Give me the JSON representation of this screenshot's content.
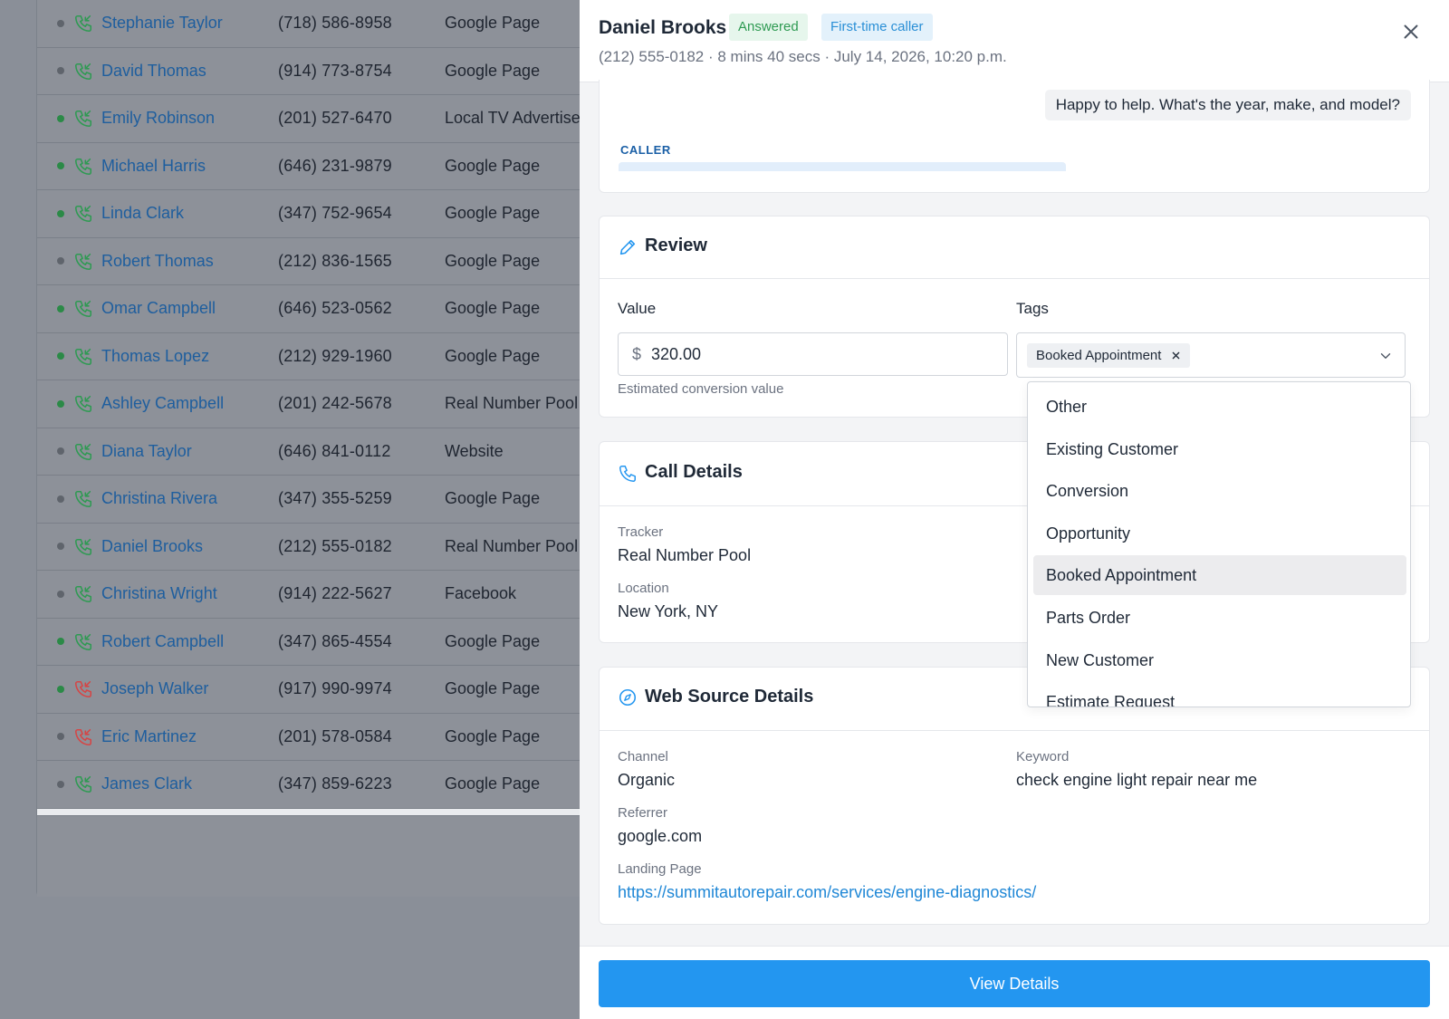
{
  "calls": [
    {
      "name": "Stephanie Taylor",
      "phone": "(718) 586-8958",
      "source": "Google Page",
      "status": "gray",
      "missed": false
    },
    {
      "name": "David Thomas",
      "phone": "(914) 773-8754",
      "source": "Google Page",
      "status": "gray",
      "missed": false
    },
    {
      "name": "Emily Robinson",
      "phone": "(201) 527-6470",
      "source": "Local TV Advertise",
      "status": "green",
      "missed": false
    },
    {
      "name": "Michael Harris",
      "phone": "(646) 231-9879",
      "source": "Google Page",
      "status": "green",
      "missed": false
    },
    {
      "name": "Linda Clark",
      "phone": "(347) 752-9654",
      "source": "Google Page",
      "status": "green",
      "missed": false
    },
    {
      "name": "Robert Thomas",
      "phone": "(212) 836-1565",
      "source": "Google Page",
      "status": "gray",
      "missed": false
    },
    {
      "name": "Omar Campbell",
      "phone": "(646) 523-0562",
      "source": "Google Page",
      "status": "green",
      "missed": false
    },
    {
      "name": "Thomas Lopez",
      "phone": "(212) 929-1960",
      "source": "Google Page",
      "status": "green",
      "missed": false
    },
    {
      "name": "Ashley Campbell",
      "phone": "(201) 242-5678",
      "source": "Real Number Pool",
      "status": "green",
      "missed": false
    },
    {
      "name": "Diana Taylor",
      "phone": "(646) 841-0112",
      "source": "Website",
      "status": "gray",
      "missed": false
    },
    {
      "name": "Christina Rivera",
      "phone": "(347) 355-5259",
      "source": "Google Page",
      "status": "gray",
      "missed": false
    },
    {
      "name": "Daniel Brooks",
      "phone": "(212) 555-0182",
      "source": "Real Number Pool",
      "status": "gray",
      "missed": false
    },
    {
      "name": "Christina Wright",
      "phone": "(914) 222-5627",
      "source": "Facebook",
      "status": "gray",
      "missed": false
    },
    {
      "name": "Robert Campbell",
      "phone": "(347) 865-4554",
      "source": "Google Page",
      "status": "green",
      "missed": false
    },
    {
      "name": "Joseph Walker",
      "phone": "(917) 990-9974",
      "source": "Google Page",
      "status": "green",
      "missed": true
    },
    {
      "name": "Eric Martinez",
      "phone": "(201) 578-0584",
      "source": "Google Page",
      "status": "gray",
      "missed": true
    },
    {
      "name": "James Clark",
      "phone": "(347) 859-6223",
      "source": "Google Page",
      "status": "gray",
      "missed": false
    }
  ],
  "drawer": {
    "name": "Daniel Brooks",
    "badge_answered": "Answered",
    "badge_first": "First-time caller",
    "subtitle": "(212) 555-0182 · 8 mins 40 secs · July 14, 2026, 10:20 p.m.",
    "close_icon": "close-icon"
  },
  "transcript": {
    "agent_message": "Happy to help. What's the year, make, and model?",
    "caller_label": "CALLER"
  },
  "review": {
    "title": "Review",
    "value_label": "Value",
    "currency": "$",
    "value": "320.00",
    "value_hint": "Estimated conversion value",
    "tags_label": "Tags",
    "selected_tag": "Booked Appointment"
  },
  "tag_options": [
    "Other",
    "Existing Customer",
    "Conversion",
    "Opportunity",
    "Booked Appointment",
    "Parts Order",
    "New Customer",
    "Estimate Request"
  ],
  "call_details": {
    "title": "Call Details",
    "tracker_label": "Tracker",
    "tracker": "Real Number Pool",
    "location_label": "Location",
    "location": "New York, NY"
  },
  "web_source": {
    "title": "Web Source Details",
    "channel_label": "Channel",
    "channel": "Organic",
    "keyword_label": "Keyword",
    "keyword": "check engine light repair near me",
    "referrer_label": "Referrer",
    "referrer": "google.com",
    "landing_label": "Landing Page",
    "landing": "https://summitautorepair.com/services/engine-diagnostics/"
  },
  "footer": {
    "button": "View Details"
  },
  "colors": {
    "accent": "#2396f0",
    "link": "#1e5e9e",
    "green": "#2e9a52",
    "red": "#d64545"
  }
}
